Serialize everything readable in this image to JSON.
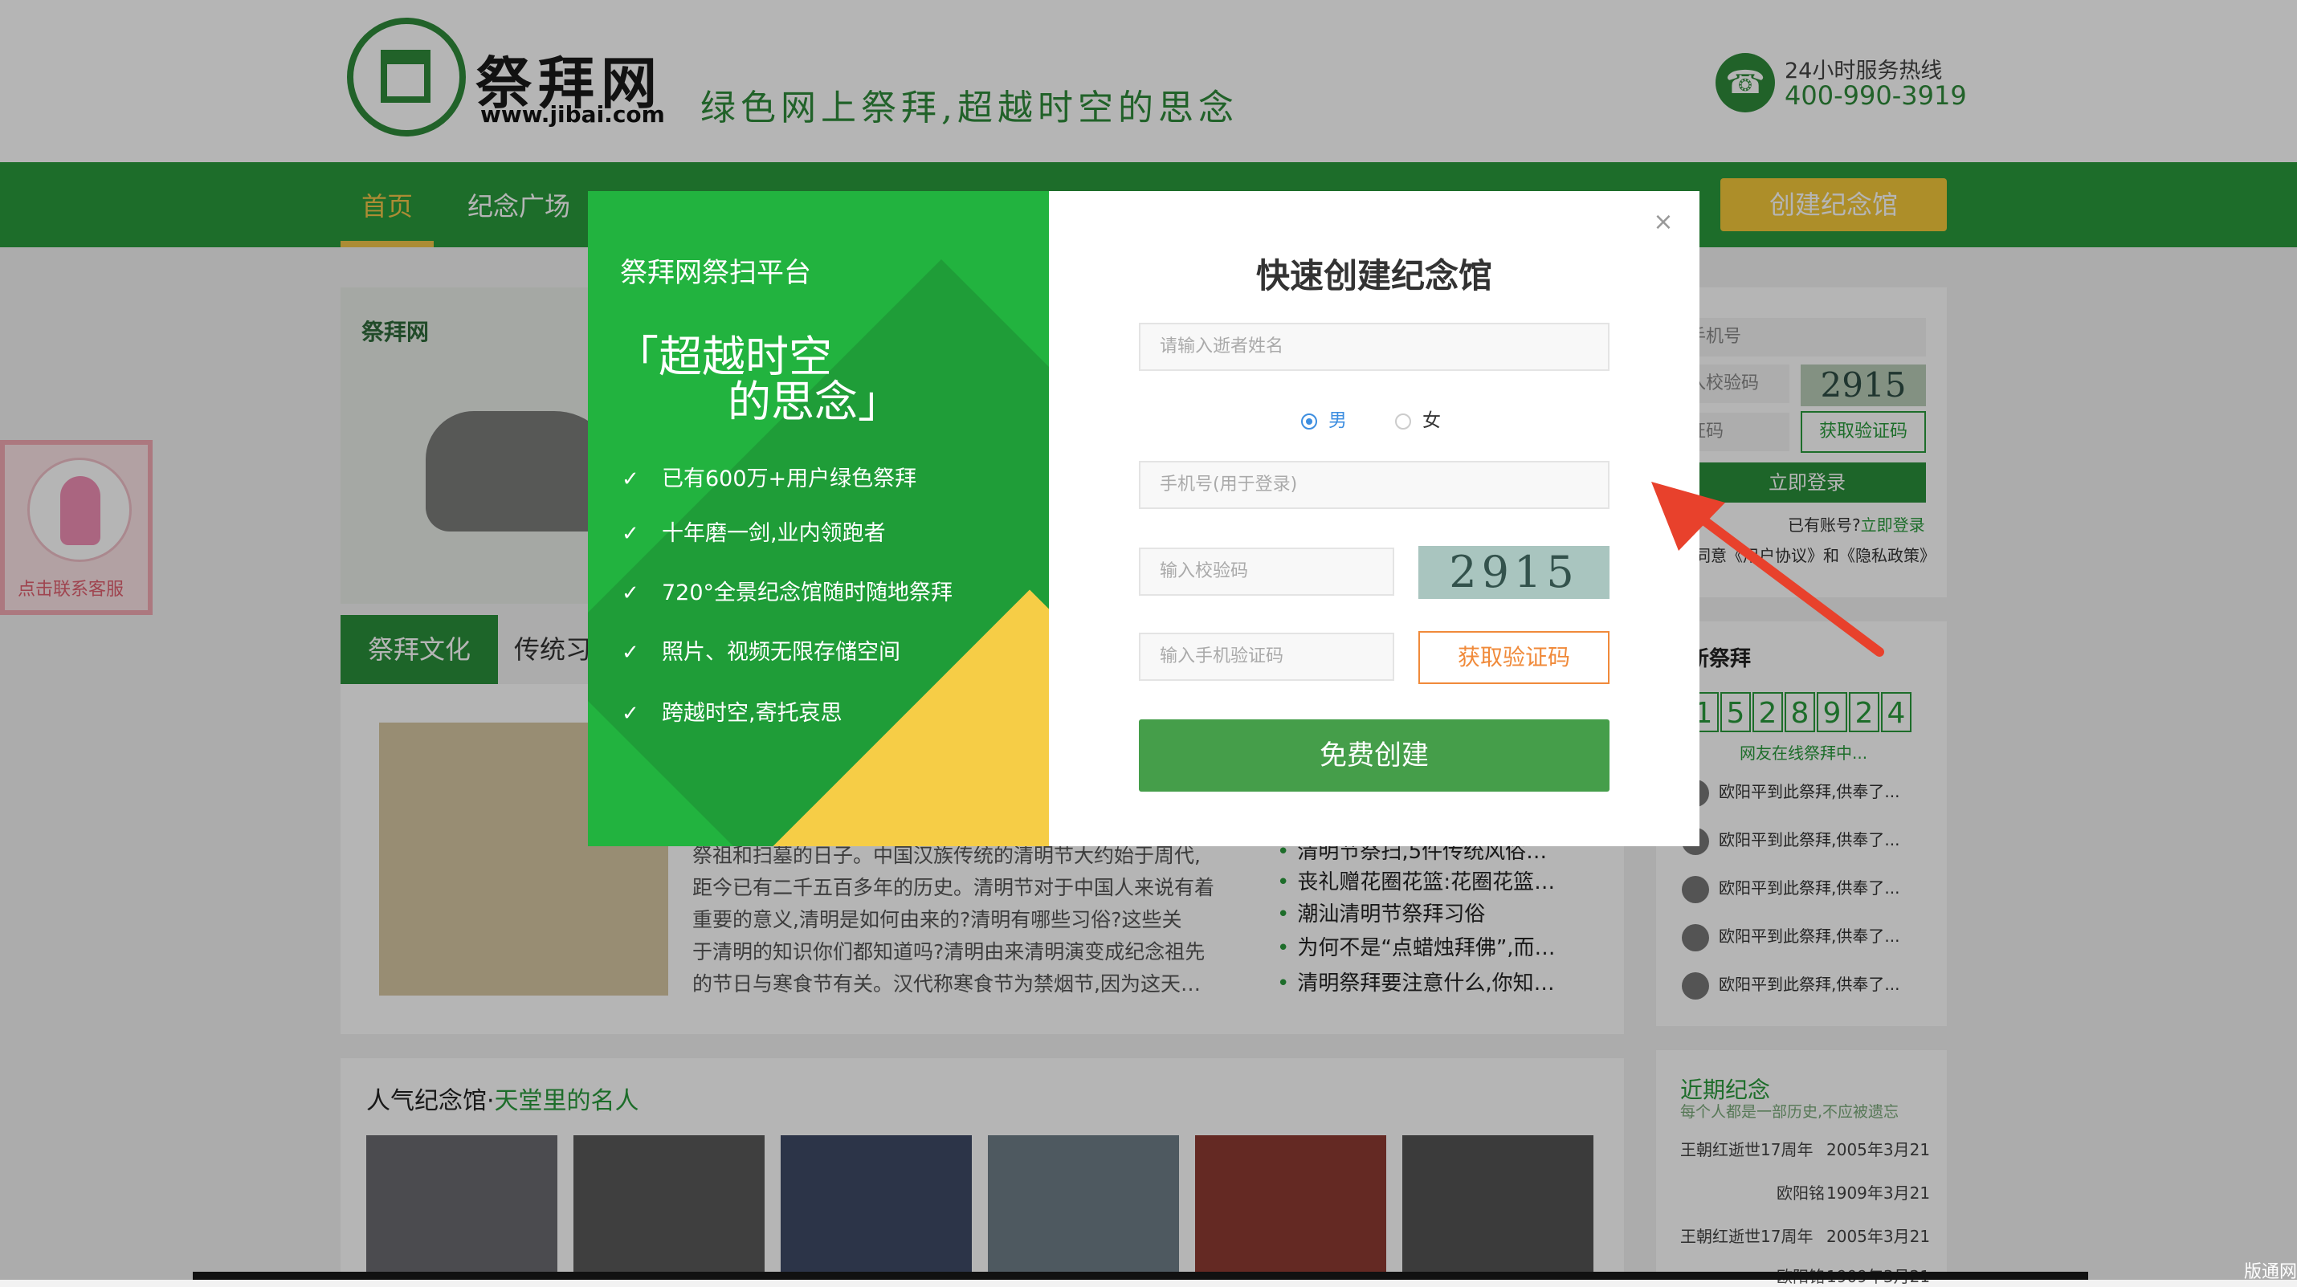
{
  "header": {
    "logo_title": "祭拜网",
    "logo_url": "www.jibai.com",
    "slogan": "绿色网上祭拜,超越时空的思念",
    "hotline_label": "24小时服务热线",
    "hotline_number": "400-990-3919"
  },
  "nav": {
    "home": "首页",
    "square": "纪念广场",
    "create": "创建纪念馆"
  },
  "content": {
    "banner_logo": "祭拜网",
    "tab_culture": "祭拜文化",
    "tab_tradition": "传统习",
    "article_lines": [
      "祭祖和扫墓的日子。中国汉族传统的清明节大约始于周代,",
      "距今已有二千五百多年的历史。清明节对于中国人来说有着",
      "重要的意义,清明是如何由来的?清明有哪些习俗?这些关",
      "于清明的知识你们都知道吗?清明由来清明演变成纪念祖先",
      "的节日与寒食节有关。汉代称寒食节为禁烟节,因为这天…"
    ],
    "news_items": [
      "清明节祭扫,5件传统风俗…",
      "丧礼赠花圈花篮:花圈花篮…",
      "潮汕清明节祭拜习俗",
      "为何不是“点蜡烛拜佛”,而…",
      "清明祭拜要注意什么,你知…"
    ],
    "popular_title": "人气纪念馆·",
    "popular_highlight": "天堂里的名人"
  },
  "login": {
    "phone": "手机号",
    "captcha_input": "入校验码",
    "captcha_code": "2915",
    "sms_input": "证码",
    "get_code": "获取验证码",
    "login_btn": "立即登录",
    "have_account": "已有账号?",
    "login_link": "立即登录",
    "agree": "同意《用户协议》和《隐私政策》"
  },
  "recent": {
    "title": "新祭拜",
    "counter": [
      "1",
      "5",
      "2",
      "8",
      "9",
      "2",
      "4"
    ],
    "online": "网友在线祭拜中...",
    "items": [
      "欧阳平到此祭拜,供奉了...",
      "欧阳平到此祭拜,供奉了...",
      "欧阳平到此祭拜,供奉了...",
      "欧阳平到此祭拜,供奉了...",
      "欧阳平到此祭拜,供奉了..."
    ]
  },
  "memorial": {
    "title": "近期纪念",
    "subtitle": "每个人都是一部历史,不应被遗忘",
    "rows": [
      {
        "name": "王朝红逝世17周年",
        "date": "2005年3月21"
      },
      {
        "name": "欧阳铭",
        "date": "1909年3月21"
      },
      {
        "name": "王朝红逝世17周年",
        "date": "2005年3月21"
      },
      {
        "name": "欧阳铭",
        "date": "1909年3月21"
      }
    ]
  },
  "customer_service": {
    "label": "点击联系客服"
  },
  "modal": {
    "platform": "祭拜网祭扫平台",
    "quote_line1": "「超越时空",
    "quote_line2": "的思念」",
    "features": [
      "已有600万+用户绿色祭拜",
      "十年磨一剑,业内领跑者",
      "720°全景纪念馆随时随地祭拜",
      "照片、视频无限存储空间",
      "跨越时空,寄托哀思"
    ],
    "title": "快速创建纪念馆",
    "name_placeholder": "请输入逝者姓名",
    "gender_male": "男",
    "gender_female": "女",
    "phone_placeholder": "手机号(用于登录)",
    "captcha_placeholder": "输入校验码",
    "captcha_code": "2915",
    "sms_placeholder": "输入手机验证码",
    "get_code": "获取验证码",
    "submit": "免费创建",
    "close": "×"
  },
  "watermark": "版通网",
  "colors": {
    "brand_green": "#2a9a3c",
    "modal_green": "#22b33f",
    "accent_yellow": "#f4c93a",
    "code_orange": "#f08a3a",
    "arrow_red": "#e8412c"
  }
}
